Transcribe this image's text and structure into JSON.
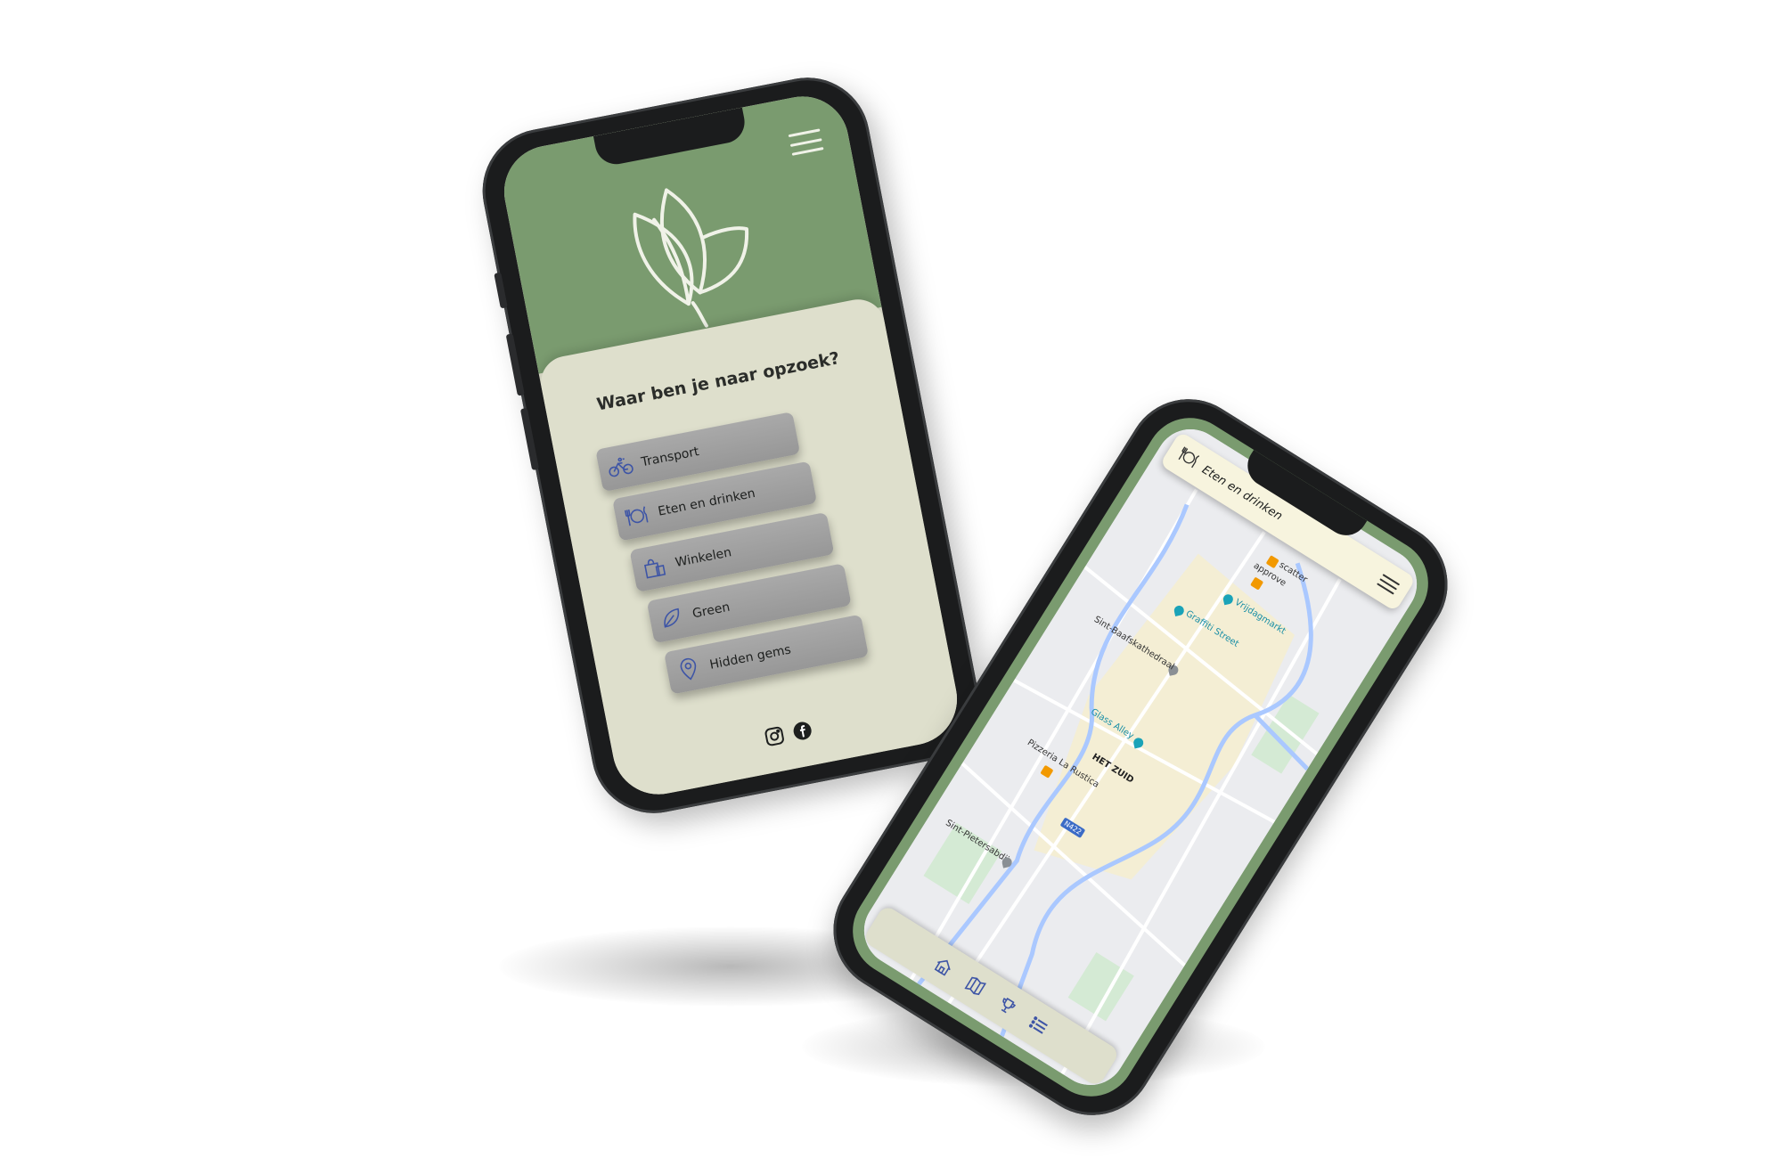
{
  "home": {
    "question": "Waar ben je naar opzoek?",
    "options": [
      {
        "label": "Transport",
        "icon": "bicycle-icon"
      },
      {
        "label": "Eten en drinken",
        "icon": "cutlery-icon"
      },
      {
        "label": "Winkelen",
        "icon": "shopping-bag-icon"
      },
      {
        "label": "Green",
        "icon": "leaf-icon"
      },
      {
        "label": "Hidden gems",
        "icon": "location-pin-icon"
      }
    ],
    "social": [
      "instagram-icon",
      "facebook-icon"
    ]
  },
  "map": {
    "header_title": "Eten en drinken",
    "places": {
      "scatter": "scatter",
      "approve": "approve",
      "vrijdagmarkt": "Vrijdagmarkt",
      "graffiti": "Graffiti Street",
      "sint_baafs": "Sint-Baafskathedraal",
      "glass_alley": "Glass Alley",
      "het_zuid": "HET ZUID",
      "pizzeria": "Pizzeria La Rustica",
      "sint_pieters": "Sint-Pietersabdij",
      "road": "N422"
    },
    "nav": [
      "home-icon",
      "map-icon",
      "trophy-icon",
      "list-icon"
    ]
  },
  "colors": {
    "sage_green": "#7a9b6f",
    "cream": "#dedfcc",
    "button_grey": "#a0a0a0",
    "icon_blue": "#3e55a6",
    "phone_body": "#1b1c1d"
  }
}
